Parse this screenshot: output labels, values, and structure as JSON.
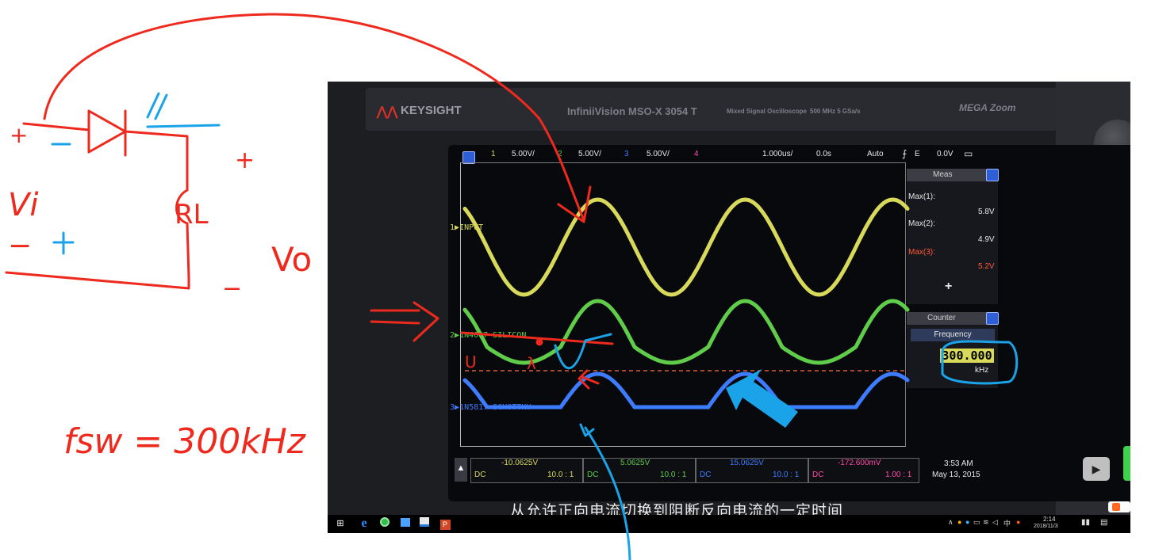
{
  "scope": {
    "brand": "KEYSIGHT",
    "model": "InfiniiVision MSO-X 3054 T",
    "model_sub": "Mixed Signal Oscilloscope",
    "specs": "500 MHz  5 GSa/s",
    "zoom_logo": "MEGA Zoom",
    "top_bar": {
      "ch1_num": "1",
      "ch1_scale": "5.00V/",
      "ch2_num": "2",
      "ch2_scale": "5.00V/",
      "ch3_num": "3",
      "ch3_scale": "5.00V/",
      "ch4_num": "4",
      "timebase": "1.000us/",
      "delay": "0.0s",
      "trigger_mode": "Auto",
      "trigger_e": "E",
      "trigger_level": "0.0V"
    },
    "traces": [
      {
        "marker": "1",
        "label": "INPUT",
        "color": "#d8d95a"
      },
      {
        "marker": "2",
        "label": "1N4007 SILICON",
        "color": "#5fcd4a"
      },
      {
        "marker": "3",
        "label": "1N5817 SCHOTTKY",
        "color": "#3d7bff"
      }
    ],
    "meas": {
      "title": "Meas",
      "items": [
        {
          "name": "Max(1):",
          "value": "5.8V",
          "color": "#e6e6e6"
        },
        {
          "name": "Max(2):",
          "value": "4.9V",
          "color": "#e6e6e6"
        },
        {
          "name": "Max(3):",
          "value": "5.2V",
          "color": "#ff5a3a"
        }
      ],
      "add": "+"
    },
    "counter": {
      "title": "Counter",
      "button": "Frequency",
      "value": "300.000",
      "unit": "kHz"
    },
    "channels_bottom": [
      {
        "offset": "-10.0625V",
        "coupling": "DC",
        "probe": "10.0 : 1",
        "color": "#d8d95a"
      },
      {
        "offset": "5.0625V",
        "coupling": "DC",
        "probe": "10.0 : 1",
        "color": "#5fcd4a"
      },
      {
        "offset": "15.0625V",
        "coupling": "DC",
        "probe": "10.0 : 1",
        "color": "#3d7bff"
      },
      {
        "offset": "-172.600mV",
        "coupling": "DC",
        "probe": "1.00 : 1",
        "color": "#ff4aa8"
      }
    ],
    "clock_time": "3:53 AM",
    "clock_date": "May 13, 2015",
    "subtitle": "从允许正向电流切换到阻断反向电流的一定时间"
  },
  "taskbar": {
    "time": "2:14",
    "date": "2018/11/3",
    "ime": "中"
  },
  "annotations": {
    "left_plus": "+",
    "left_minus": "−",
    "right_plus": "+",
    "right_minus": "−",
    "vi": "Vi",
    "rl": "RL",
    "vo": "Vo",
    "fsw": "fsw = 300kHz",
    "u_mark": "U",
    "lambda_mark": "λ"
  },
  "colors": {
    "ink_red": "#ee2a1e",
    "ink_blue": "#1aa3e8",
    "trace_yellow": "#d8d95a",
    "trace_green": "#5fcd4a",
    "trace_blue": "#3d7bff"
  }
}
